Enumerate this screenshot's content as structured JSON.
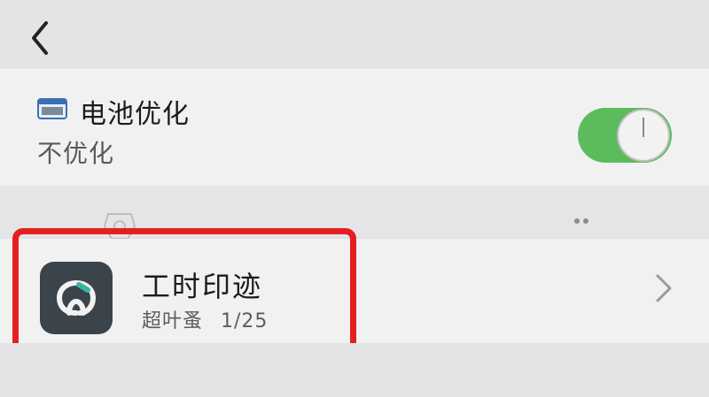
{
  "nav": {
    "back_icon": "chevron-left-icon"
  },
  "battery": {
    "icon": "battery-settings-icon",
    "title": "电池优化",
    "status": "不优化",
    "toggle_on": true,
    "toggle_color": "#5cbb5d"
  },
  "app": {
    "name": "工时印迹",
    "developer": "超叶蚤",
    "version": "1/25",
    "icon": "app-logo-icon",
    "icon_bg": "#3b444b",
    "accent": "#3ab3a5",
    "chevron_icon": "chevron-right-icon"
  },
  "highlight": {
    "color": "#e51f1f"
  }
}
